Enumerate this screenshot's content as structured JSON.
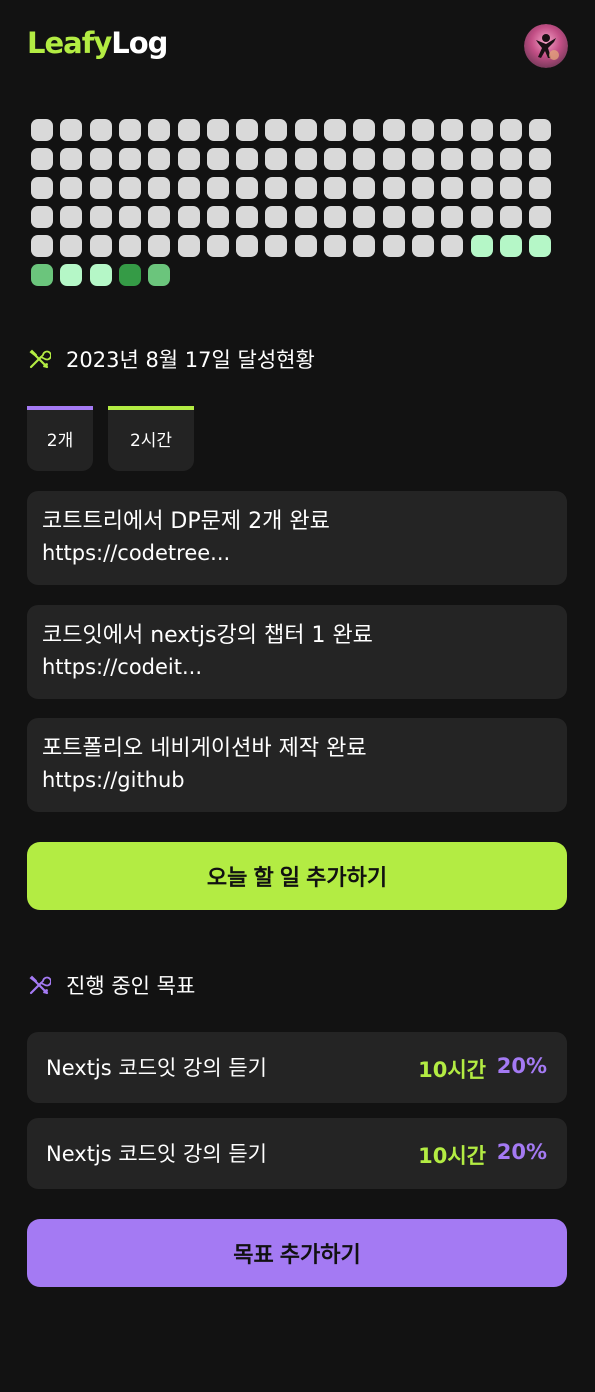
{
  "header": {
    "logo_part1": "Leafy",
    "logo_part2": "Log",
    "avatar_icon": "user-avatar"
  },
  "contribution_grid": {
    "legend": {
      "0": "#d9d9d9",
      "1": "#b5f7c7",
      "2": "#6bc57c",
      "3": "#359b46"
    },
    "levels": [
      0,
      0,
      0,
      0,
      0,
      0,
      0,
      0,
      0,
      0,
      0,
      0,
      0,
      0,
      0,
      0,
      0,
      0,
      0,
      0,
      0,
      0,
      0,
      0,
      0,
      0,
      0,
      0,
      0,
      0,
      0,
      0,
      0,
      0,
      0,
      0,
      0,
      0,
      0,
      0,
      0,
      0,
      0,
      0,
      0,
      0,
      0,
      0,
      0,
      0,
      0,
      0,
      0,
      0,
      0,
      0,
      0,
      0,
      0,
      0,
      0,
      0,
      0,
      0,
      0,
      0,
      0,
      0,
      0,
      0,
      0,
      0,
      0,
      0,
      0,
      0,
      0,
      0,
      0,
      0,
      0,
      0,
      0,
      0,
      0,
      0,
      0,
      1,
      1,
      1,
      2,
      1,
      1,
      3,
      2
    ]
  },
  "achievement": {
    "icon": "tools-icon",
    "title": "2023년 8월 17일 달성현황",
    "stats": [
      {
        "label": "2개",
        "accent": "#a47af3"
      },
      {
        "label": "2시간",
        "accent": "#b3ec43"
      }
    ]
  },
  "tasks": [
    {
      "title": "코트트리에서 DP문제 2개 완료",
      "link": "https://codetree..."
    },
    {
      "title": "코드잇에서 nextjs강의 챕터 1 완료",
      "link": "https://codeit..."
    },
    {
      "title": "포트폴리오 네비게이션바 제작 완료",
      "link": "https://github"
    }
  ],
  "add_task_button": "오늘 할 일 추가하기",
  "goals_section": {
    "icon": "tools-icon",
    "title": "진행 중인 목표",
    "items": [
      {
        "name": "Nextjs 코드잇 강의 듣기",
        "hours": "10시간",
        "percent": "20%"
      },
      {
        "name": "Nextjs 코드잇 강의 듣기",
        "hours": "10시간",
        "percent": "20%"
      }
    ]
  },
  "add_goal_button": "목표 추가하기",
  "colors": {
    "background": "#121212",
    "card": "#242424",
    "green_accent": "#b3ec43",
    "purple_accent": "#a47af3"
  }
}
